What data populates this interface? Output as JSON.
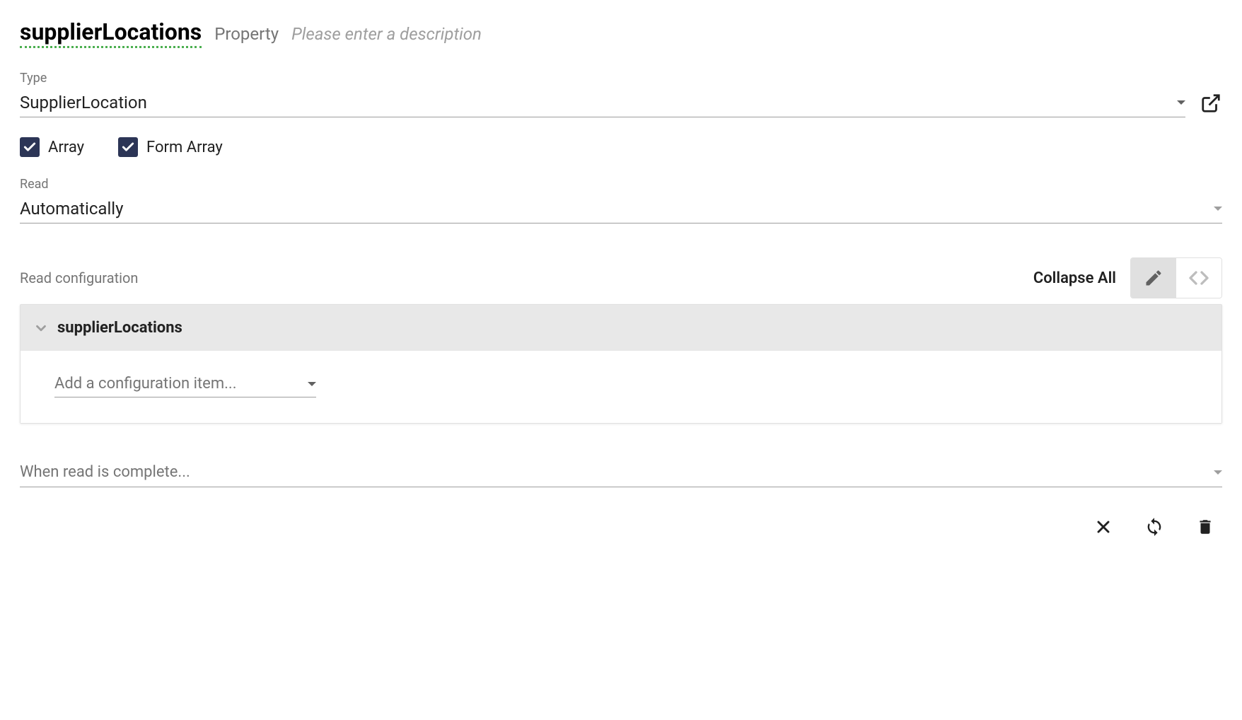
{
  "header": {
    "title": "supplierLocations",
    "subtitle": "Property",
    "description_placeholder": "Please enter a description"
  },
  "type_field": {
    "label": "Type",
    "value": "SupplierLocation"
  },
  "checkboxes": {
    "array": {
      "label": "Array",
      "checked": true
    },
    "form_array": {
      "label": "Form Array",
      "checked": true
    }
  },
  "read_field": {
    "label": "Read",
    "value": "Automatically"
  },
  "read_config": {
    "label": "Read configuration",
    "collapse_all": "Collapse All",
    "panel_title": "supplierLocations",
    "add_placeholder": "Add a configuration item..."
  },
  "when_complete": {
    "placeholder": "When read is complete..."
  }
}
